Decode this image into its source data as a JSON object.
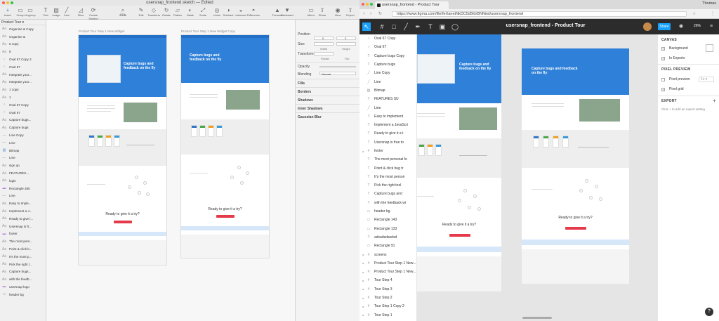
{
  "sketch": {
    "window_title": "usersnap_frontend.sketch — Edited",
    "toolbar": [
      {
        "label": "Insert",
        "icon": "plus-icon",
        "glyph": "+"
      },
      {
        "label": "Group",
        "icon": "group-icon",
        "glyph": "▭"
      },
      {
        "label": "Ungroup",
        "icon": "ungroup-icon",
        "glyph": "▭"
      },
      {
        "label": "Text",
        "icon": "text-icon",
        "glyph": "T"
      },
      {
        "label": "Image",
        "icon": "image-icon",
        "glyph": "▨"
      },
      {
        "label": "Line",
        "icon": "line-icon",
        "glyph": "╱"
      },
      {
        "label": "Slice",
        "icon": "slice-icon",
        "glyph": "◿"
      },
      {
        "label": "Create Symbol",
        "icon": "symbol-icon",
        "glyph": "⟳"
      },
      {
        "label": "Zoom",
        "icon": "zoom-icon",
        "glyph": "⌕",
        "value": "27%"
      },
      {
        "label": "Edit",
        "icon": "edit-icon",
        "glyph": "✎"
      },
      {
        "label": "Transform",
        "icon": "transform-icon",
        "glyph": "◇"
      },
      {
        "label": "Rotate",
        "icon": "rotate-icon",
        "glyph": "↻"
      },
      {
        "label": "Flatten",
        "icon": "flatten-icon",
        "glyph": "▱"
      },
      {
        "label": "Mask",
        "icon": "mask-icon",
        "glyph": "◐"
      },
      {
        "label": "Scale",
        "icon": "scale-icon",
        "glyph": "⤢"
      },
      {
        "label": "Union",
        "icon": "union-icon",
        "glyph": "◎"
      },
      {
        "label": "Subtract",
        "icon": "subtract-icon",
        "glyph": "◑"
      },
      {
        "label": "Intersect",
        "icon": "intersect-icon",
        "glyph": "◒"
      },
      {
        "label": "Difference",
        "icon": "difference-icon",
        "glyph": "◓"
      },
      {
        "label": "Forward",
        "icon": "forward-icon",
        "glyph": "▲"
      },
      {
        "label": "Backward",
        "icon": "backward-icon",
        "glyph": "▼"
      },
      {
        "label": "Mirror",
        "icon": "mirror-icon",
        "glyph": "▭"
      },
      {
        "label": "Share",
        "icon": "share-icon",
        "glyph": "⇪"
      },
      {
        "label": "View",
        "icon": "view-icon",
        "glyph": "◉"
      },
      {
        "label": "Export",
        "icon": "export-icon",
        "glyph": "⇧"
      }
    ],
    "page_selector": "Product Tour",
    "layers": [
      {
        "name": "Organise & Copy",
        "icon": "text"
      },
      {
        "name": "Organise &",
        "icon": "text"
      },
      {
        "name": "5 copy",
        "icon": "text"
      },
      {
        "name": "5",
        "icon": "text"
      },
      {
        "name": "Oval 67 Copy 2",
        "icon": "oval"
      },
      {
        "name": "Oval 67",
        "icon": "oval"
      },
      {
        "name": "Integrate your...",
        "icon": "text"
      },
      {
        "name": "Integrate your...",
        "icon": "text"
      },
      {
        "name": "1 copy",
        "icon": "text"
      },
      {
        "name": "1",
        "icon": "text"
      },
      {
        "name": "Oval 67 Copy",
        "icon": "oval"
      },
      {
        "name": "Oval 67",
        "icon": "oval"
      },
      {
        "name": "Capture bugs...",
        "icon": "text"
      },
      {
        "name": "Capture bugs",
        "icon": "text"
      },
      {
        "name": "Line Copy",
        "icon": "line"
      },
      {
        "name": "Line",
        "icon": "line"
      },
      {
        "name": "Bitmap",
        "icon": "bitmap"
      },
      {
        "name": "Line",
        "icon": "line"
      },
      {
        "name": "sign up",
        "icon": "text"
      },
      {
        "name": "FEATURES...",
        "icon": "text"
      },
      {
        "name": "login",
        "icon": "text"
      },
      {
        "name": "Rectangle 280",
        "icon": "folder"
      },
      {
        "name": "Line",
        "icon": "line"
      },
      {
        "name": "Easy to Imple...",
        "icon": "text"
      },
      {
        "name": "Implement a J...",
        "icon": "text"
      },
      {
        "name": "Ready to give i...",
        "icon": "text"
      },
      {
        "name": "Usersnap is fr...",
        "icon": "text"
      },
      {
        "name": "footer",
        "icon": "folder"
      },
      {
        "name": "The most pers...",
        "icon": "text"
      },
      {
        "name": "Point & click b...",
        "icon": "text"
      },
      {
        "name": "It's the most p...",
        "icon": "text"
      },
      {
        "name": "Pick the right t...",
        "icon": "text"
      },
      {
        "name": "Capture bugs...",
        "icon": "text"
      },
      {
        "name": "with the feedb...",
        "icon": "text"
      },
      {
        "name": "usersnap logo",
        "icon": "folder"
      },
      {
        "name": "header bg",
        "icon": "rect"
      }
    ],
    "artboards": [
      {
        "label": "Product Tour Step 1 New Widget",
        "headline": "Capture bugs and feedback on the fly",
        "cta": "Ready to give it a try?"
      },
      {
        "label": "Product Tour Step 1 New Widget Copy",
        "headline": "Capture bugs and feedback on the fly",
        "cta": "Ready to give it a try?"
      }
    ],
    "inspector": {
      "position": "Position",
      "x_label": "X",
      "y_label": "Y",
      "x": "0",
      "y": "0",
      "size": "Size",
      "width_label": "Width",
      "height_label": "Height",
      "transform": "Transform",
      "rotate_label": "Rotate",
      "flip_label": "Flip",
      "opacity": "Opacity",
      "blending": "Blending",
      "blending_value": "Normal",
      "fills": "Fills",
      "borders": "Borders",
      "shadows": "Shadows",
      "inner_shadows": "Inner Shadows",
      "gaussian_blur": "Gaussian Blur"
    }
  },
  "chrome": {
    "tab_title": "usersnap_frontend - Product Tour",
    "user": "Thomas",
    "url": "https://www.figma.com/file/feXanetNkDC5d5fdrBNNiwt/usersnap_frontend"
  },
  "figma": {
    "file_title": "usersnap_frontend - Product Tour",
    "share_label": "Share",
    "zoom": "26%",
    "layers": [
      {
        "name": "Oval 67 Copy",
        "icon": "oval",
        "arrow": false
      },
      {
        "name": "Oval 67",
        "icon": "oval",
        "arrow": false
      },
      {
        "name": "Capture bugs Copy",
        "icon": "text",
        "arrow": false
      },
      {
        "name": "Capture bugs",
        "icon": "text",
        "arrow": false
      },
      {
        "name": "Line Copy",
        "icon": "line",
        "arrow": false
      },
      {
        "name": "Line",
        "icon": "line",
        "arrow": false
      },
      {
        "name": "Bitmap",
        "icon": "image",
        "arrow": false
      },
      {
        "name": "FEATURES       SU",
        "icon": "text",
        "arrow": false
      },
      {
        "name": "Line",
        "icon": "line",
        "arrow": false
      },
      {
        "name": "Easy to implement",
        "icon": "text",
        "arrow": false
      },
      {
        "name": "Implement a JavaScri",
        "icon": "text",
        "arrow": false
      },
      {
        "name": "Ready to give it a t",
        "icon": "text",
        "arrow": false
      },
      {
        "name": "Usersnap is free to",
        "icon": "text",
        "arrow": false
      },
      {
        "name": "footer",
        "icon": "frame",
        "arrow": true
      },
      {
        "name": "The most personal fe",
        "icon": "text",
        "arrow": false
      },
      {
        "name": "Point & click bug tr",
        "icon": "text",
        "arrow": false
      },
      {
        "name": "It's the most person",
        "icon": "text",
        "arrow": false
      },
      {
        "name": "Pick the right tool",
        "icon": "text",
        "arrow": false
      },
      {
        "name": "Capture bugs and",
        "icon": "text",
        "arrow": false
      },
      {
        "name": "with the feedback wi",
        "icon": "text",
        "arrow": false
      },
      {
        "name": "header bg",
        "icon": "rect",
        "arrow": false
      },
      {
        "name": "Rectangle 143",
        "icon": "rect",
        "arrow": false
      },
      {
        "name": "Rectangle 133",
        "icon": "rect",
        "arrow": false
      },
      {
        "name": "adsadsdasdsd",
        "icon": "text",
        "arrow": false
      },
      {
        "name": "Rectangle 91",
        "icon": "rect",
        "arrow": false
      },
      {
        "name": "screens",
        "icon": "frame",
        "arrow": true
      },
      {
        "name": "Product Tour Step 1 New...",
        "icon": "frame",
        "arrow": true
      },
      {
        "name": "Product Tour Step 1 New...",
        "icon": "frame",
        "arrow": true
      },
      {
        "name": "Tour Step 4",
        "icon": "frame",
        "arrow": true
      },
      {
        "name": "Tour Step 3",
        "icon": "frame",
        "arrow": true
      },
      {
        "name": "Tour Step 2",
        "icon": "frame",
        "arrow": true
      },
      {
        "name": "Tour Step 1 Copy 2",
        "icon": "frame",
        "arrow": true
      },
      {
        "name": "Tour Step 1",
        "icon": "frame",
        "arrow": true
      }
    ],
    "artboards": [
      {
        "headline": "Capture bugs and feedback on the fly",
        "cta": "Ready to give it a try?"
      },
      {
        "headline": "Capture bugs and feedback on the fly",
        "cta": "Ready to give it a try?"
      }
    ],
    "props": {
      "canvas_header": "CANVAS",
      "background_label": "Background",
      "in_exports_label": "In Exports",
      "pixel_preview_header": "PIXEL PREVIEW",
      "pixel_preview_label": "Pixel preview",
      "pixel_preview_value": "1x",
      "pixel_grid_label": "Pixel grid",
      "export_header": "EXPORT",
      "export_hint": "Click + to add an export setting"
    },
    "help": "?"
  },
  "colors": {
    "hero_blue": "#2f80d8",
    "figma_blue": "#18a0fb",
    "cta_red": "#e53a4a",
    "traffic_red": "#fc5f57",
    "traffic_yellow": "#fdbc2e",
    "traffic_green": "#28c840"
  }
}
